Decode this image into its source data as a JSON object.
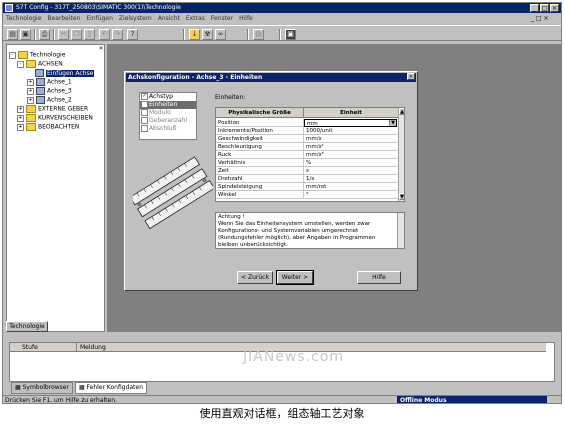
{
  "window": {
    "title": "S7T Config - 317T_250803\\SIMATIC 300(1)\\Technologie",
    "min": "_",
    "max": "□",
    "close": "×"
  },
  "menu": [
    "Technologie",
    "Bearbeiten",
    "Einfügen",
    "Zielsystem",
    "Ansicht",
    "Extras",
    "Fenster",
    "Hilfe"
  ],
  "menu_right": "_ □ ×",
  "tree": {
    "root": "Technologie",
    "achsen": "ACHSEN",
    "selected": "Einfügen Achse",
    "achse1": "Achse_1",
    "achse3": "Achse_3",
    "achse2": "Achse_2",
    "externe": "EXTERNE GEBER",
    "kurven": "KURVENSCHEIBEN",
    "nocken": "BEOBACHTEN",
    "tab": "Technologie"
  },
  "dialog": {
    "title": "Achskonfiguration - Achse_3 - Einheiten",
    "close": "×",
    "steps": [
      {
        "label": "Achstyp",
        "checked": "✓"
      },
      {
        "label": "Einheiten",
        "checked": ""
      },
      {
        "label": "Modulo",
        "checked": ""
      },
      {
        "label": "Geberanzahl",
        "checked": ""
      },
      {
        "label": "Abschluß",
        "checked": ""
      }
    ],
    "einheiten_label": "Einheiten:",
    "col1": "Physikalische Größe",
    "col2": "Einheit",
    "rows": [
      {
        "groesse": "Position",
        "einheit": "mm"
      },
      {
        "groesse": "Inkremente/Position",
        "einheit": "1000/unit"
      },
      {
        "groesse": "Geschwindigkeit",
        "einheit": "mm/s"
      },
      {
        "groesse": "Beschleunigung",
        "einheit": "mm/s²"
      },
      {
        "groesse": "Ruck",
        "einheit": "mm/s³"
      },
      {
        "groesse": "Verhältnis",
        "einheit": "%"
      },
      {
        "groesse": "Zeit",
        "einheit": "s"
      },
      {
        "groesse": "Drehzahl",
        "einheit": "1/s"
      },
      {
        "groesse": "Spindelsteigung",
        "einheit": "mm/rot"
      },
      {
        "groesse": "Winkel",
        "einheit": "°"
      }
    ],
    "note_title": "Achtung !",
    "note_text": "Wenn Sie das Einheitensystem umstellen, werden zwar Konfigurations- und Systemvariablen umgerechnet (Rundungsfehler möglich), aber Angaben in Programmen bleiben unberücksichtigt.",
    "btn_back": "< Zurück",
    "btn_next": "Weiter >",
    "btn_help": "Hilfe"
  },
  "lower": {
    "col_stufe": "Stufe",
    "col_meldung": "Meldung",
    "tab1": "Symbolbrowser",
    "tab2": "Fehler Konfigdaten"
  },
  "status": {
    "hint": "Drücken Sie F1, um Hilfe zu erhalten.",
    "mode": "Offline Modus"
  },
  "watermark": "JIANews.com",
  "caption": "使用直观对话框，组态轴工艺对象"
}
